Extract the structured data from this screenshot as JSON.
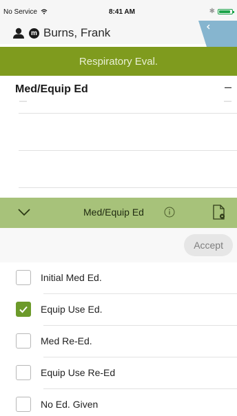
{
  "status_bar": {
    "carrier": "No Service",
    "time": "8:41 AM",
    "bluetooth": "✱",
    "wifi_icon": "wifi-icon",
    "battery_level": 0.9,
    "battery_color": "#1ca44a"
  },
  "patient": {
    "name": "Burns, Frank",
    "badge": "m",
    "person_icon": "person-icon"
  },
  "title_bar": {
    "title": "Respiratory Eval.",
    "color": "#7f9b1e"
  },
  "section": {
    "heading": "Med/Equip Ed",
    "dash": "–",
    "sub_left": "—",
    "sub_right": "—"
  },
  "collapse_bar": {
    "title": "Med/Equip Ed",
    "info_icon": "info-icon",
    "doc_icon": "document-settings-icon",
    "chevron_icon": "chevron-down-icon",
    "color": "#a7c27a"
  },
  "accept_label": "Accept",
  "checklist": [
    {
      "label": "Initial Med Ed.",
      "checked": false
    },
    {
      "label": "Equip Use Ed.",
      "checked": true
    },
    {
      "label": "Med Re-Ed.",
      "checked": false
    },
    {
      "label": "Equip Use Re-Ed",
      "checked": false
    },
    {
      "label": "No Ed. Given",
      "checked": false
    }
  ]
}
